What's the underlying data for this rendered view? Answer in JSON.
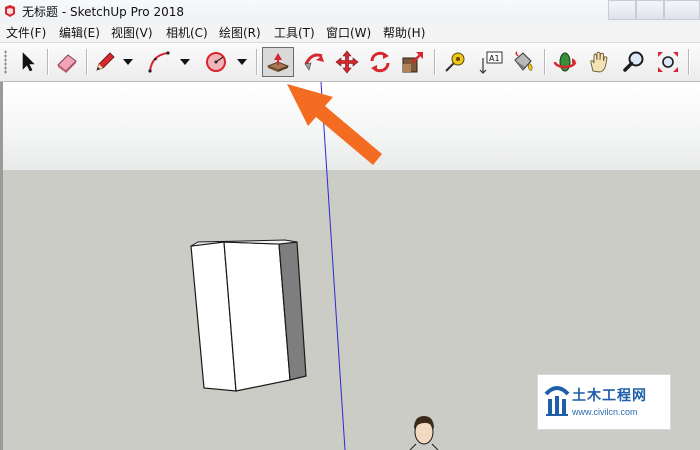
{
  "window": {
    "title": "无标题 - SketchUp Pro 2018"
  },
  "menu": {
    "items": [
      {
        "label": "文件(F)"
      },
      {
        "label": "编辑(E)"
      },
      {
        "label": "视图(V)"
      },
      {
        "label": "相机(C)"
      },
      {
        "label": "绘图(R)"
      },
      {
        "label": "工具(T)"
      },
      {
        "label": "窗口(W)"
      },
      {
        "label": "帮助(H)"
      }
    ]
  },
  "toolbar": {
    "tools": [
      {
        "icon": "select-arrow-icon"
      },
      {
        "icon": "eraser-icon"
      },
      {
        "icon": "pencil-line-icon",
        "has_dropdown": true
      },
      {
        "icon": "arc-icon",
        "has_dropdown": true
      },
      {
        "icon": "circle-icon",
        "has_dropdown": true
      },
      {
        "icon": "push-pull-icon",
        "active": true
      },
      {
        "icon": "follow-me-icon"
      },
      {
        "icon": "move-icon"
      },
      {
        "icon": "rotate-icon"
      },
      {
        "icon": "scale-icon"
      },
      {
        "icon": "tape-measure-icon"
      },
      {
        "icon": "text-icon",
        "label": "A1"
      },
      {
        "icon": "paint-bucket-icon"
      },
      {
        "icon": "orbit-icon"
      },
      {
        "icon": "pan-hand-icon"
      },
      {
        "icon": "zoom-icon"
      },
      {
        "icon": "zoom-extents-icon"
      }
    ]
  },
  "annotation": {
    "arrow_color": "#f36c21"
  },
  "colors": {
    "accent": "#f36c21",
    "ground": "#cbccc5",
    "axis_blue": "#2b2bd0"
  },
  "watermark": {
    "title": "土木工程网",
    "url": "www.civilcn.com"
  }
}
